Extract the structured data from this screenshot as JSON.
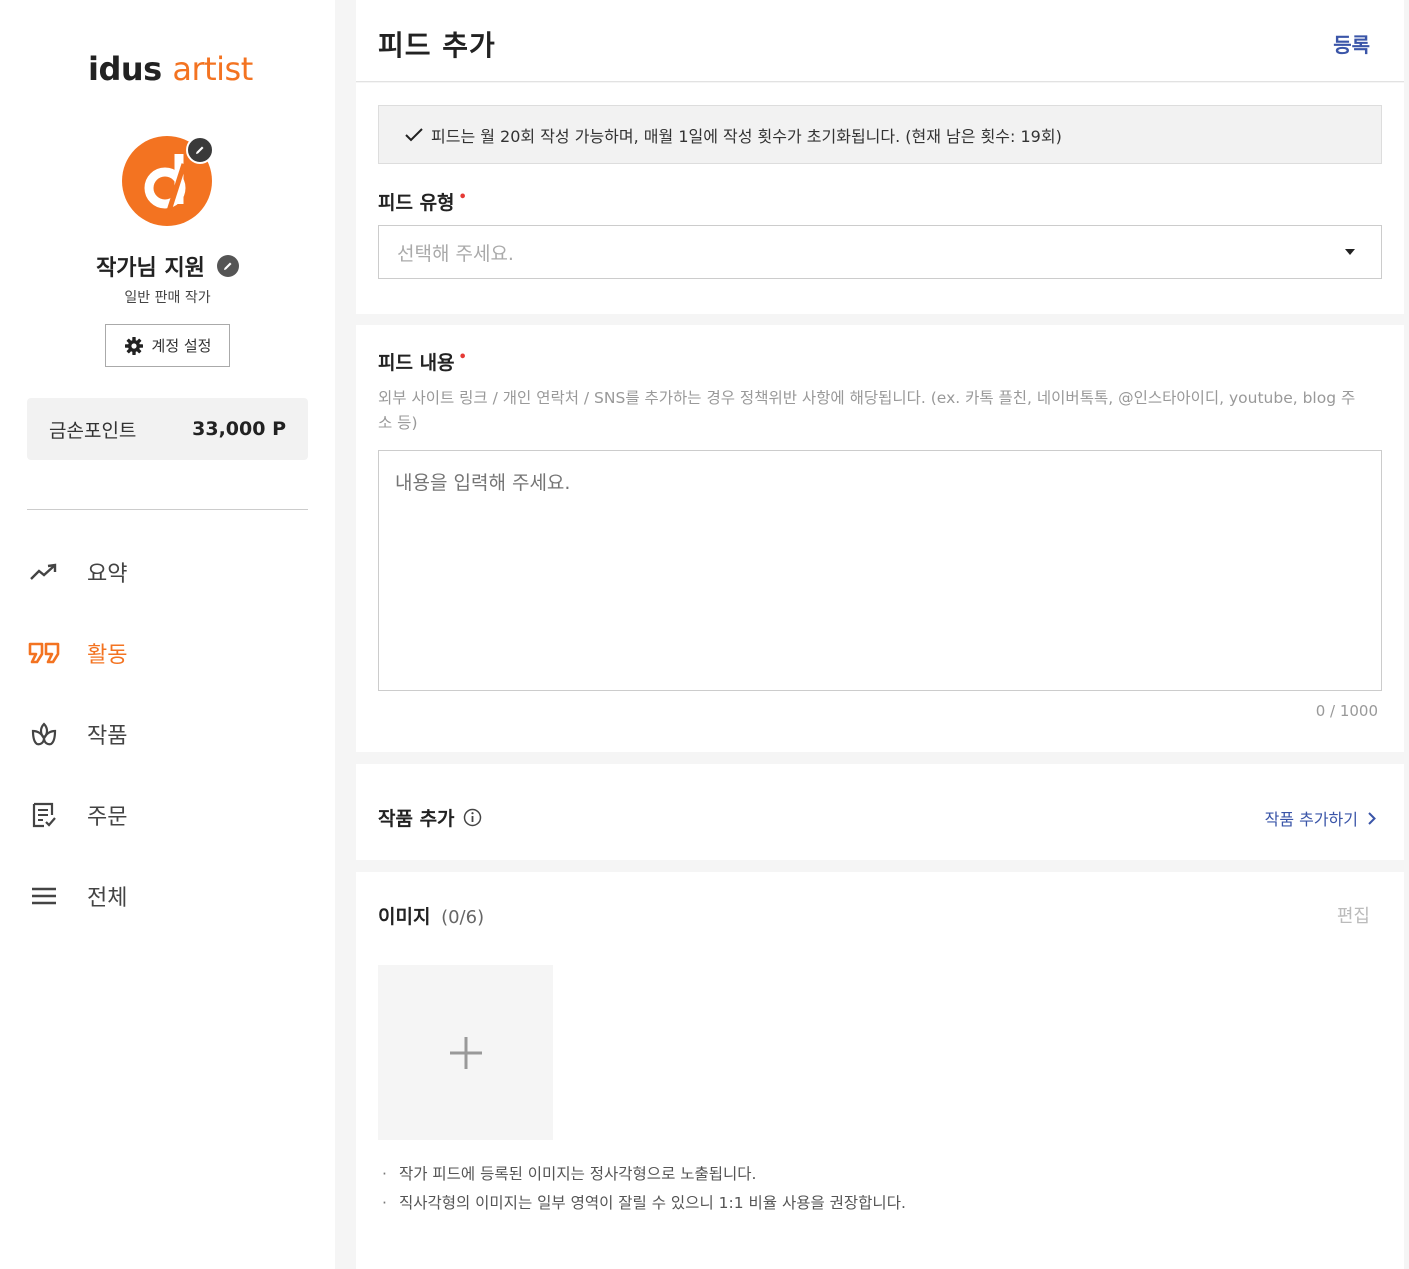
{
  "logo": {
    "part1": "idus",
    "part2": "artist"
  },
  "profile": {
    "name": "작가님 지원",
    "type": "일반 판매 작가",
    "settings_label": "계정 설정"
  },
  "points": {
    "label": "금손포인트",
    "value": "33,000 P"
  },
  "nav": [
    {
      "label": "요약",
      "icon": "trend-icon"
    },
    {
      "label": "활동",
      "icon": "quote-icon",
      "active": true
    },
    {
      "label": "작품",
      "icon": "lotus-icon"
    },
    {
      "label": "주문",
      "icon": "order-list-icon"
    },
    {
      "label": "전체",
      "icon": "menu-icon"
    }
  ],
  "header": {
    "title": "피드 추가",
    "register_label": "등록"
  },
  "notice": "피드는 월 20회 작성 가능하며, 매월 1일에 작성 횟수가 초기화됩니다. (현재 남은 횟수: 19회)",
  "feed_type": {
    "label": "피드 유형",
    "required_mark": "•",
    "placeholder": "선택해 주세요."
  },
  "feed_content": {
    "label": "피드 내용",
    "required_mark": "•",
    "hint": "외부 사이트 링크 / 개인 연락처 / SNS를 추가하는 경우 정책위반 사항에 해당됩니다. (ex. 카톡 플친, 네이버톡톡, @인스타아이디, youtube, blog 주소 등)",
    "placeholder": "내용을 입력해 주세요.",
    "counter": "0 / 1000"
  },
  "product": {
    "label": "작품 추가",
    "add_label": "작품 추가하기"
  },
  "images": {
    "label": "이미지",
    "count": "(0/6)",
    "edit_label": "편집",
    "notes": [
      "작가 피드에 등록된 이미지는 정사각형으로 노출됩니다.",
      "직사각형의 이미지는 일부 영역이 잘릴 수 있으니 1:1 비율 사용을 권장합니다."
    ]
  },
  "colors": {
    "accent": "#f37321",
    "link": "#3a55a8",
    "required": "#e53935"
  }
}
